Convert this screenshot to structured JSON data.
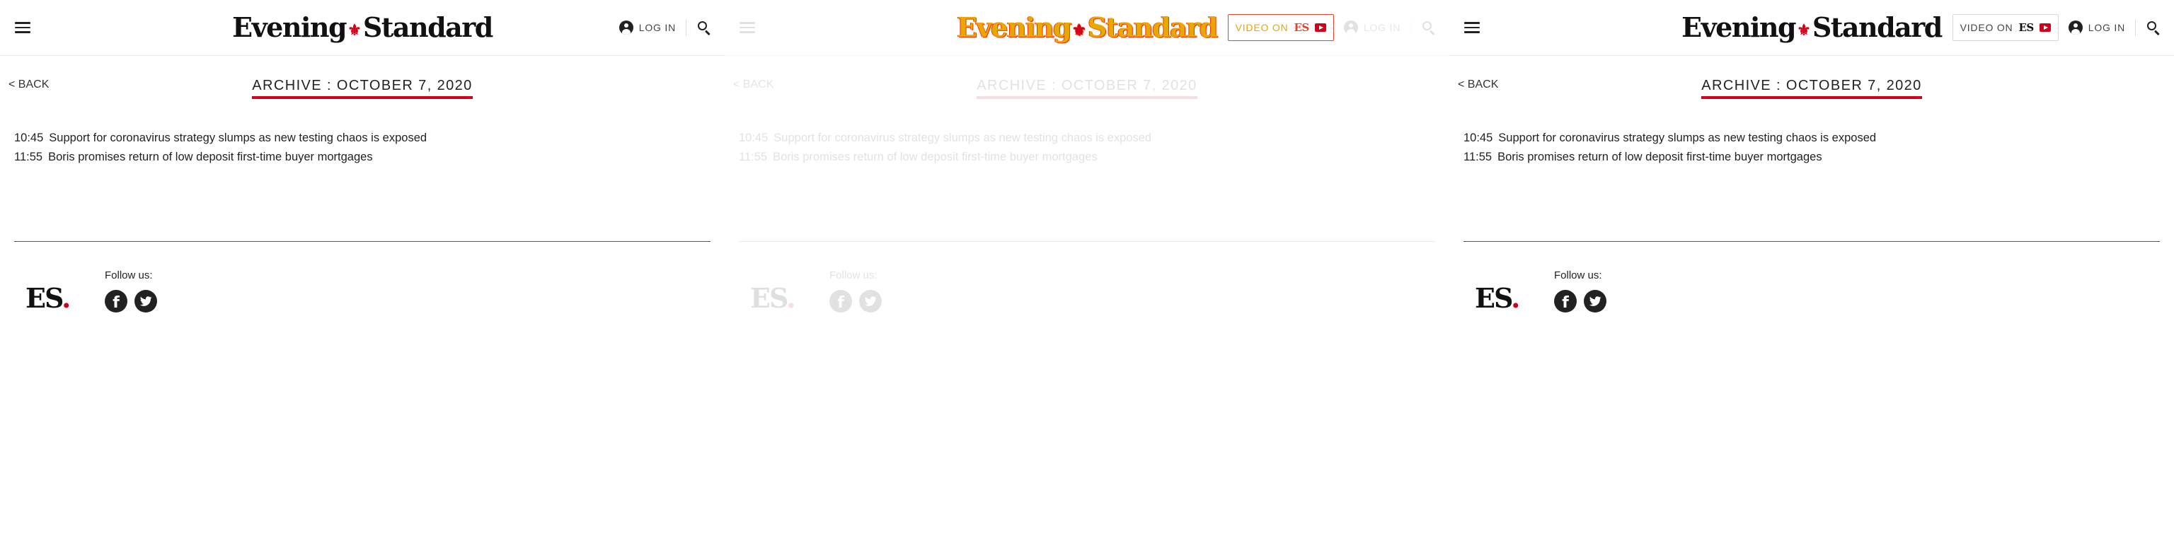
{
  "header": {
    "logo_left": "Evening",
    "logo_ornament": "⚜",
    "logo_right": "Standard",
    "video_label": "VIDEO ON",
    "video_brand": "ES",
    "login_label": "LOG IN"
  },
  "page": {
    "back_label": "< BACK",
    "archive_title": "ARCHIVE : OCTOBER 7, 2020"
  },
  "articles": [
    {
      "time": "10:45",
      "headline": "Support for coronavirus strategy slumps as new testing chaos is exposed"
    },
    {
      "time": "11:55",
      "headline": "Boris promises return of low deposit first-time buyer mortgages"
    }
  ],
  "footer": {
    "logo_text": "ES",
    "logo_dot": ".",
    "follow_label": "Follow us:",
    "facebook_glyph": "f"
  },
  "colors": {
    "accent_red": "#d0021b",
    "text_dark": "#222222",
    "loading_yellow": "#e8a800"
  },
  "icons": [
    "menu-icon",
    "user-icon",
    "search-icon",
    "play-icon",
    "facebook-icon",
    "twitter-icon"
  ]
}
